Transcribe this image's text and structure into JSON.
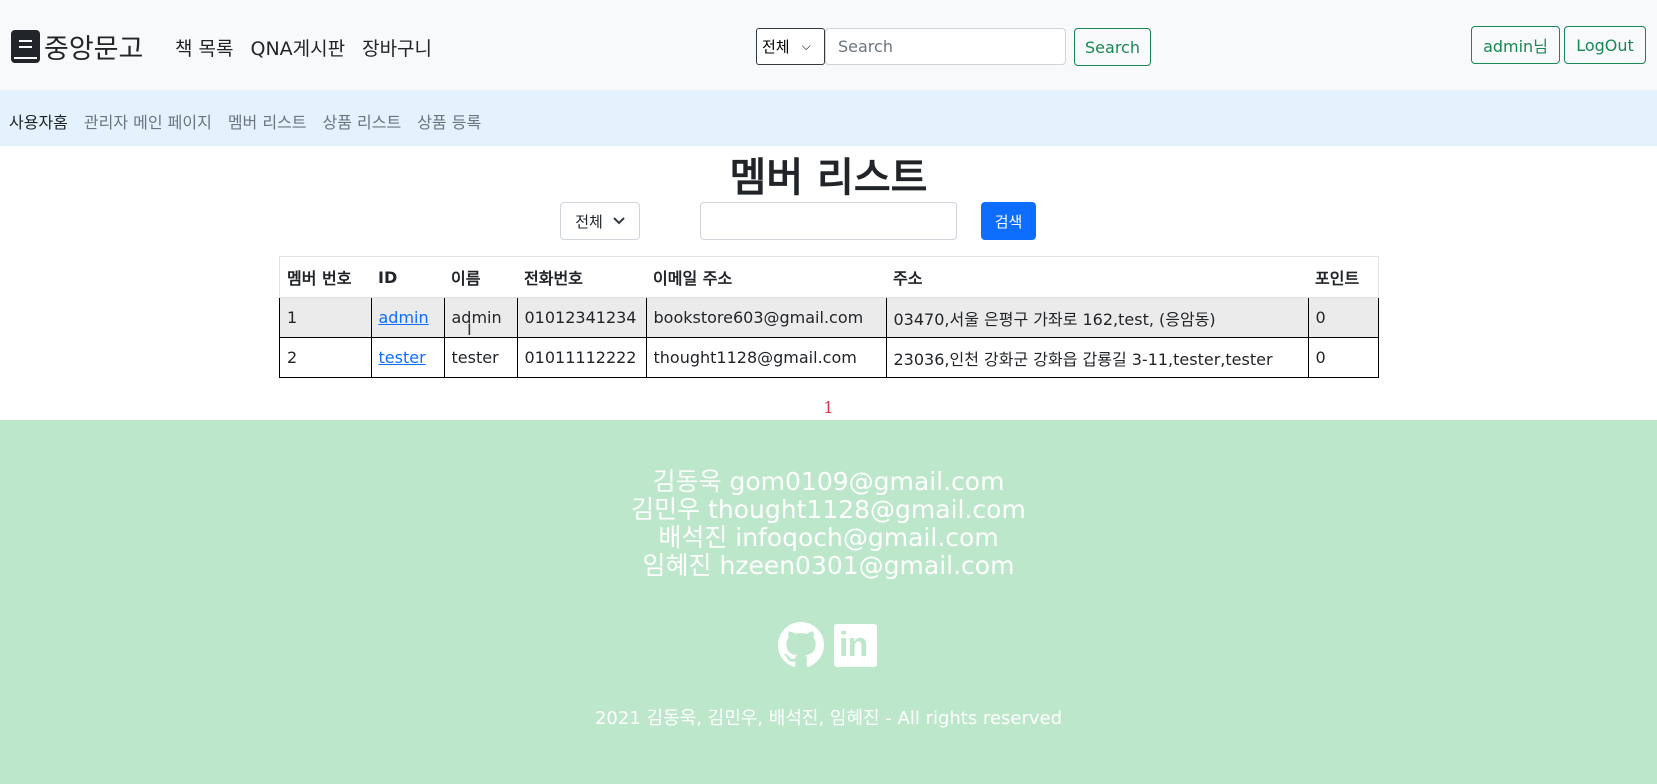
{
  "navbar": {
    "brand": "중앙문고",
    "links": [
      "책 목록",
      "QNA게시판",
      "장바구니"
    ],
    "search_scope": "전체",
    "search_placeholder": "Search",
    "search_button": "Search",
    "user_button": "admin님",
    "logout_button": "LogOut"
  },
  "subnav": {
    "items": [
      "사용자홈",
      "관리자 메인 페이지",
      "멤버 리스트",
      "상품 리스트",
      "상품 등록"
    ]
  },
  "main": {
    "title": "멤버 리스트",
    "filter_select": "전체",
    "filter_input": "",
    "filter_button": "검색",
    "table": {
      "headers": [
        "멤버 번호",
        "ID",
        "이름",
        "전화번호",
        "이메일 주소",
        "주소",
        "포인트"
      ],
      "rows": [
        {
          "no": "1",
          "id": "admin",
          "name": "admin",
          "phone": "01012341234",
          "email": "bookstore603@gmail.com",
          "address": "03470,서울 은평구 가좌로 162,test, (응암동)",
          "points": "0"
        },
        {
          "no": "2",
          "id": "tester",
          "name": "tester",
          "phone": "01011112222",
          "email": "thought1128@gmail.com",
          "address": "23036,인천 강화군 강화읍 갑룡길 3-11,tester,tester",
          "points": "0"
        }
      ]
    },
    "pagination": {
      "current": "1"
    }
  },
  "footer": {
    "contacts": [
      "김동욱 gom0109@gmail.com",
      "김민우 thought1128@gmail.com",
      "배석진 infoqoch@gmail.com",
      "임혜진 hzeen0301@gmail.com"
    ],
    "social_icons": [
      "github-icon",
      "linkedin-icon"
    ],
    "copyright": "2021 김동욱, 김민우, 배석진, 임혜진 - All rights reserved"
  },
  "colors": {
    "navbar_bg": "#f8f9fa",
    "subnav_bg": "#e3f2fd",
    "footer_bg": "#bde7ca",
    "primary": "#0d6efd",
    "success": "#198754",
    "pagination_active": "#dc3545"
  }
}
